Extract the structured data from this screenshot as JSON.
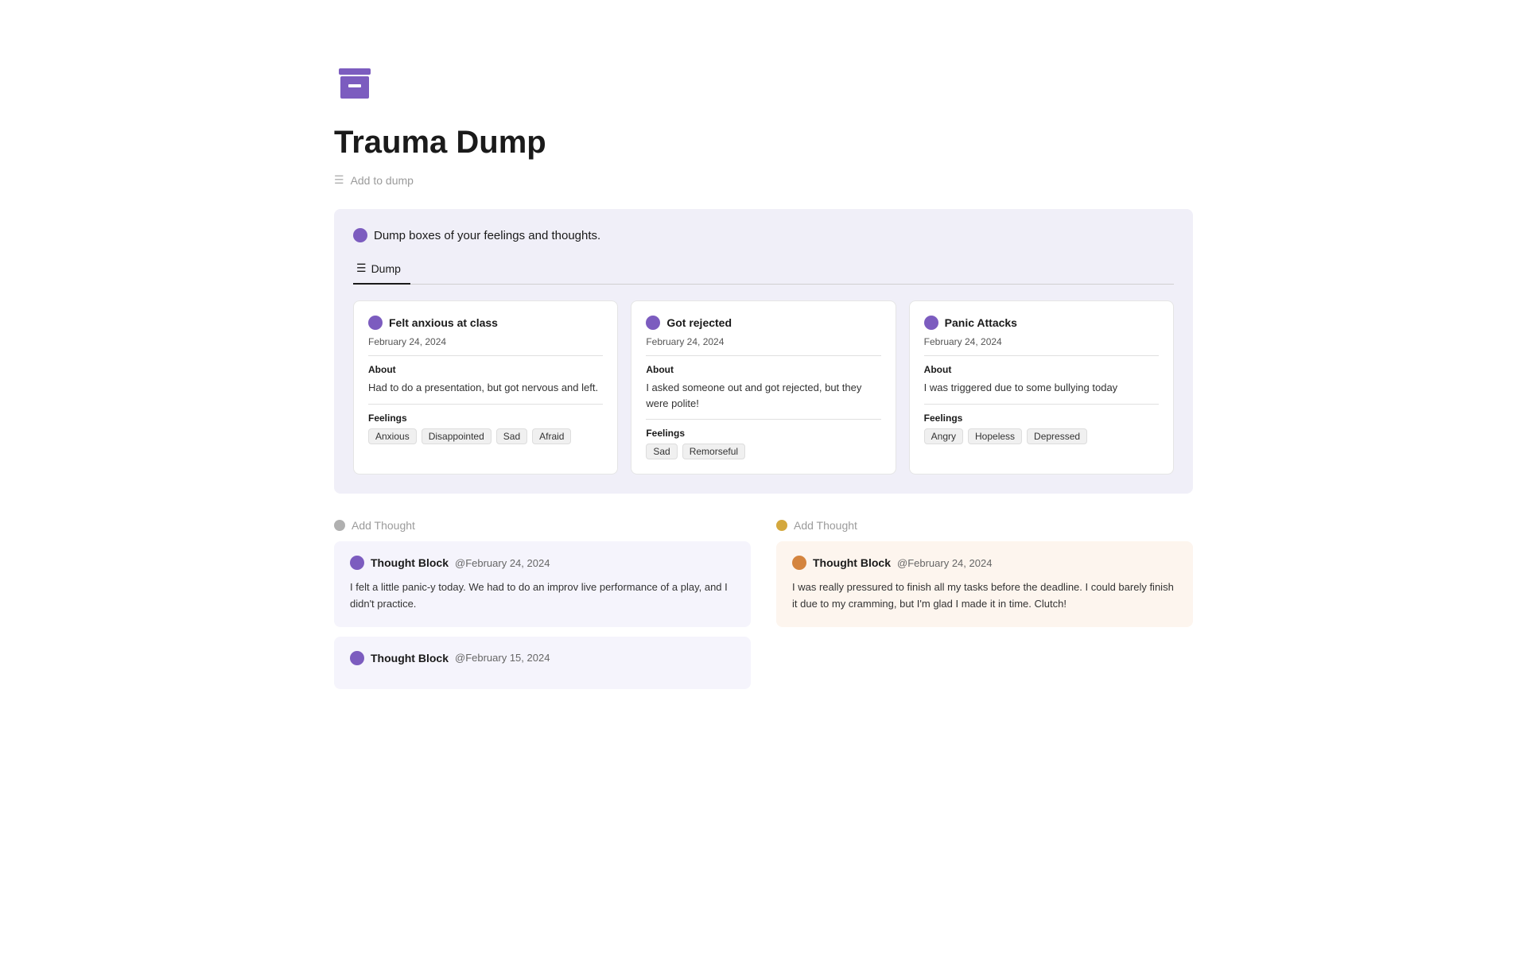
{
  "page": {
    "title": "Trauma Dump",
    "add_to_dump_label": "Add to dump",
    "section_description": "Dump boxes of your feelings and thoughts.",
    "tab_label": "Dump"
  },
  "cards": [
    {
      "title": "Felt anxious at class",
      "date": "February 24, 2024",
      "about": "Had to do a presentation, but got nervous and left.",
      "feelings": [
        "Anxious",
        "Disappointed",
        "Sad",
        "Afraid"
      ]
    },
    {
      "title": "Got rejected",
      "date": "February 24, 2024",
      "about": "I asked someone out and got rejected, but they were polite!",
      "feelings": [
        "Sad",
        "Remorseful"
      ]
    },
    {
      "title": "Panic Attacks",
      "date": "February 24, 2024",
      "about": "I was triggered due to some bullying today",
      "feelings": [
        "Angry",
        "Hopeless",
        "Depressed"
      ]
    }
  ],
  "left_column": {
    "add_thought_label": "Add Thought",
    "thought_blocks": [
      {
        "title": "Thought Block",
        "date": "@February 24, 2024",
        "text": "I felt a little panic-y today. We had to do an improv live performance of a play, and I didn't practice."
      },
      {
        "title": "Thought Block",
        "date": "@February 15, 2024",
        "text": ""
      }
    ]
  },
  "right_column": {
    "add_thought_label": "Add Thought",
    "thought_blocks": [
      {
        "title": "Thought Block",
        "date": "@February 24, 2024",
        "text": "I was really pressured to finish all my tasks before the deadline. I could barely finish it due to my cramming, but I'm glad I made it in time. Clutch!"
      }
    ]
  },
  "labels": {
    "about": "About",
    "feelings": "Feelings"
  }
}
